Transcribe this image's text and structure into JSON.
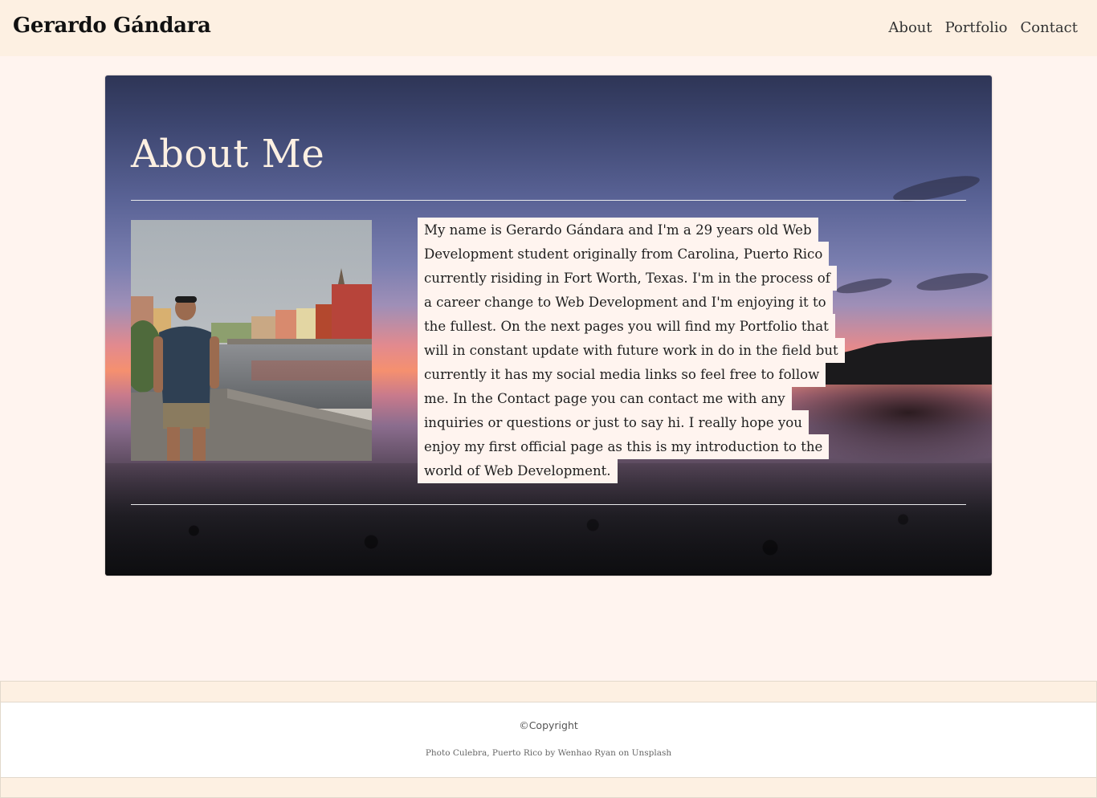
{
  "header": {
    "brand": "Gerardo Gándara",
    "nav": [
      {
        "label": "About"
      },
      {
        "label": "Portfolio"
      },
      {
        "label": "Contact"
      }
    ]
  },
  "about": {
    "title": "About Me",
    "photo_alt": "Photo of Gerardo Gándara",
    "bio": "My name is Gerardo Gándara and I'm a 29 years old Web Development student originally from Carolina, Puerto Rico currently risiding in Fort Worth, Texas. I'm in the process of a career change to Web Development and I'm enjoying it to the fullest. On the next pages you will find my Portfolio that will in constant update with future work in do in the field but currently it has my social media links so feel free to follow me. In the Contact page you can contact me with any inquiries or questions or just to say hi. I really hope you enjoy my first official page as this is my introduction to the world of Web Development."
  },
  "footer": {
    "copyright": "©Copyright",
    "credit": "Photo Culebra, Puerto Rico by Wenhao Ryan on Unsplash"
  },
  "colors": {
    "navbar_bg": "#fdf0e2",
    "page_bg": "#fff4ef",
    "heading": "#fdf0e2"
  }
}
